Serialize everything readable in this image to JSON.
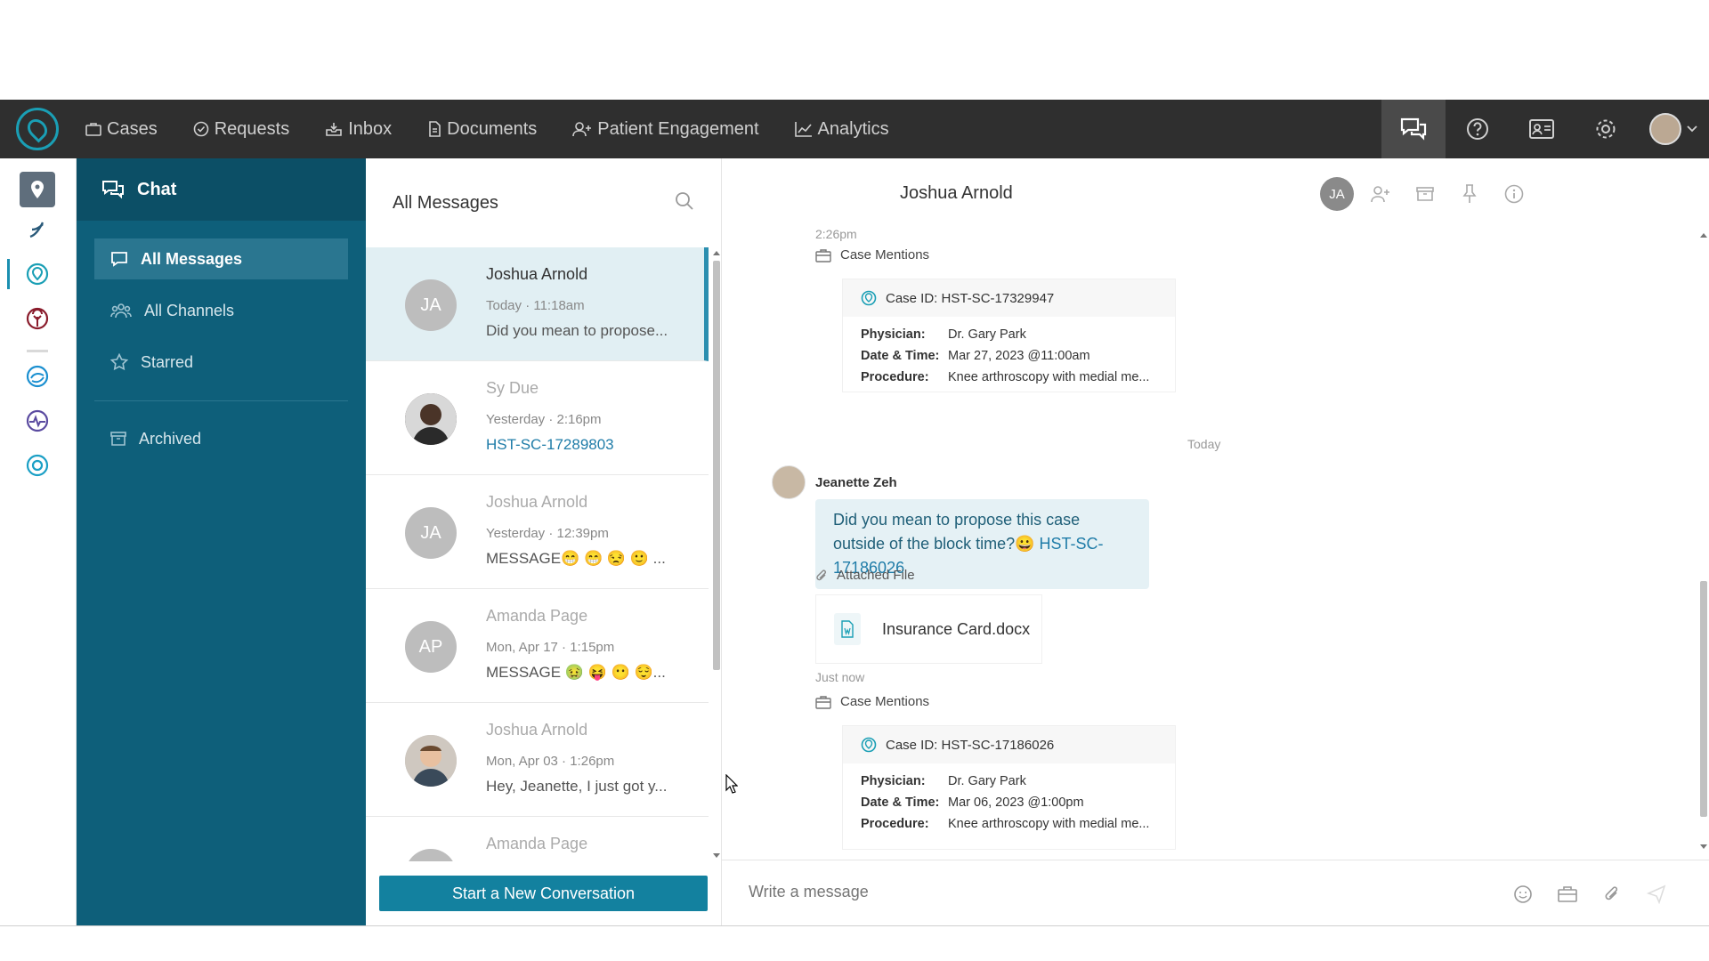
{
  "topnav": {
    "items": [
      {
        "label": "Cases",
        "icon": "briefcase-icon"
      },
      {
        "label": "Requests",
        "icon": "check-circle-icon"
      },
      {
        "label": "Inbox",
        "icon": "inbox-icon"
      },
      {
        "label": "Documents",
        "icon": "document-icon"
      },
      {
        "label": "Patient Engagement",
        "icon": "user-plus-icon"
      },
      {
        "label": "Analytics",
        "icon": "chart-icon"
      }
    ]
  },
  "side": {
    "title": "Chat",
    "items": [
      {
        "label": "All Messages"
      },
      {
        "label": "All Channels"
      },
      {
        "label": "Starred"
      },
      {
        "label": "Archived"
      }
    ]
  },
  "list": {
    "title": "All Messages",
    "conversations": [
      {
        "initials": "JA",
        "name": "Joshua Arnold",
        "time": "Today · 11:18am",
        "msg": "Did you mean to propose..."
      },
      {
        "initials": "",
        "name": "Sy Due",
        "time": "Yesterday · 2:16pm",
        "msg": "HST-SC-17289803"
      },
      {
        "initials": "JA",
        "name": "Joshua Arnold",
        "time": "Yesterday · 12:39pm",
        "msg": "MESSAGE😁 😁 😒 🙂 ..."
      },
      {
        "initials": "AP",
        "name": "Amanda Page",
        "time": "Mon, Apr 17 · 1:15pm",
        "msg": "MESSAGE 🤢 😝 😶 😌..."
      },
      {
        "initials": "",
        "name": "Joshua Arnold",
        "time": "Mon, Apr 03 · 1:26pm",
        "msg": "Hey, Jeanette, I just got y..."
      },
      {
        "initials": "",
        "name": "Amanda Page",
        "time": "",
        "msg": ""
      }
    ],
    "start_button": "Start a New Conversation"
  },
  "chat": {
    "title": "Joshua Arnold",
    "header_initials": "JA",
    "prev_time": "2:26pm",
    "case_mentions_label": "Case Mentions",
    "case1": {
      "id": "Case ID: HST-SC-17329947",
      "physician_k": "Physician:",
      "physician": "Dr. Gary Park",
      "datetime_k": "Date & Time:",
      "datetime": "Mar 27, 2023 @11:00am",
      "procedure_k": "Procedure:",
      "procedure": "Knee arthroscopy with medial me..."
    },
    "day_separator": "Today",
    "sender": "Jeanette Zeh",
    "bubble_text": "Did you mean to propose this case outside of the block time?😀 ",
    "bubble_link": "HST-SC-17186026",
    "attached_label": "Attached File",
    "file_name": "Insurance Card.docx",
    "just_now": "Just now",
    "case2": {
      "id": "Case ID: HST-SC-17186026",
      "physician_k": "Physician:",
      "physician": "Dr. Gary Park",
      "datetime_k": "Date & Time:",
      "datetime": "Mar 06, 2023 @1:00pm",
      "procedure_k": "Procedure:",
      "procedure": "Knee arthroscopy with medial me..."
    },
    "composer_placeholder": "Write a message"
  },
  "colors": {
    "topnav": "#2f2f2f",
    "sidebar": "#0e5f7a",
    "accent": "#13819f",
    "link": "#1f7ca8"
  }
}
